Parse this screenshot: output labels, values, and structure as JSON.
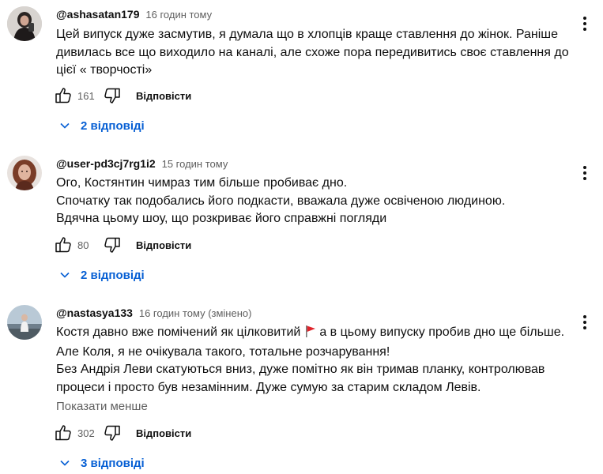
{
  "comments": [
    {
      "author": "@ashasatan179",
      "time": "16 годин тому",
      "lines": [
        "Цей випуск дуже засмутив, я думала що в хлопців краще ставлення до жінок. Раніше",
        "дивилась все що виходило на каналі, але схоже пора передивитись своє ставлення до",
        "цієї « творчості»"
      ],
      "likes": "161",
      "reply_label": "Відповісти",
      "replies_label": "2 відповіді"
    },
    {
      "author": "@user-pd3cj7rg1i2",
      "time": "15 годин тому",
      "lines": [
        "Ого, Костянтин чимраз тим більше пробиває дно.",
        "Спочатку так подобались його подкасти, вважала дуже освіченою людиною.",
        "Вдячна цьому шоу, що розкриває його справжні погляди"
      ],
      "likes": "80",
      "reply_label": "Відповісти",
      "replies_label": "2 відповіді"
    },
    {
      "author": "@nastasya133",
      "time": "16 годин тому (змінено)",
      "line1_before_flag": "Костя давно вже помічений як цілковитий",
      "line1_after_flag": "а в цьому випуску пробив дно ще більше.",
      "lines": [
        "Але Коля, я не очікувала такого, тотальне розчарування!",
        "Без Андрія Леви скатуються вниз, дуже помітно як він тримав планку, контролював",
        "процеси і просто був незамінним. Дуже сумую за старим складом Левів."
      ],
      "show_less": "Показати менше",
      "likes": "302",
      "reply_label": "Відповісти",
      "replies_label": "3 відповіді"
    }
  ],
  "icons": {
    "like": "thumb-up-icon",
    "dislike": "thumb-down-icon",
    "more": "more-vertical-icon",
    "expand": "chevron-down-icon",
    "flag": "red-flag-emoji"
  },
  "colors": {
    "author": "#0f0f0f",
    "meta": "#606060",
    "link": "#065fd4",
    "flag": "#e0242b"
  }
}
